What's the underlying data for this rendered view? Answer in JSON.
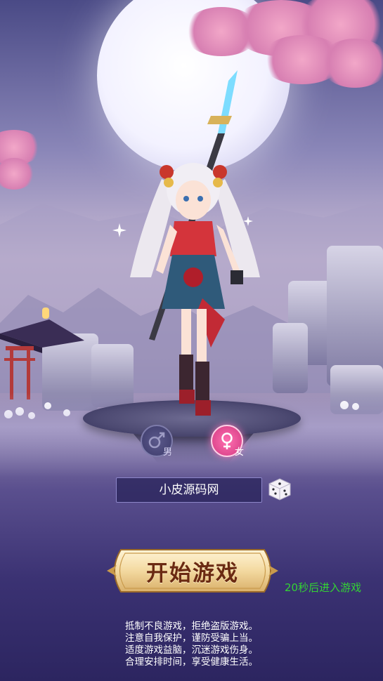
{
  "gender": {
    "male_label": "男",
    "female_label": "女",
    "selected": "female"
  },
  "character_name": "小皮源码网",
  "start_button_label": "开始游戏",
  "countdown_text": "20秒后进入游戏",
  "health_notice": [
    "抵制不良游戏，拒绝盗版游戏。",
    "注意自我保护，谨防受骗上当。",
    "适度游戏益脑，沉迷游戏伤身。",
    "合理安排时间，享受健康生活。"
  ],
  "colors": {
    "countdown": "#33d433",
    "start_button_gold": "#f3d9a0",
    "start_text": "#6b2a12",
    "female_selected": "#ff6fb0"
  }
}
